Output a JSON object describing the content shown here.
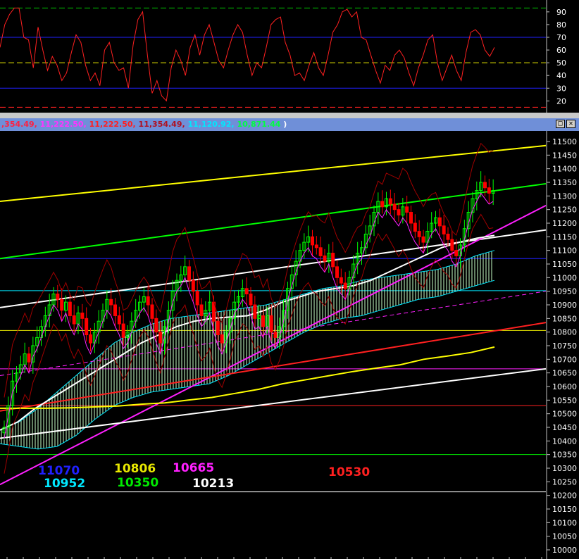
{
  "titlebar": {
    "values": [
      {
        "text": ",354.49,",
        "color": "#ff2040"
      },
      {
        "text": " 11,222.50,",
        "color": "#ff33ff"
      },
      {
        "text": " 11,222.50,",
        "color": "#ff2020"
      },
      {
        "text": " 11,354.49,",
        "color": "#b01020"
      },
      {
        "text": " 11,120.92,",
        "color": "#00e8ff"
      },
      {
        "text": " 10,871.44",
        "color": "#00ff40"
      },
      {
        "text": " )",
        "color": "#ffffff"
      }
    ],
    "minimize_label": "□",
    "close_label": "✕"
  },
  "rsi_panel": {
    "ticks": [
      90,
      80,
      70,
      60,
      50,
      40,
      30,
      20
    ],
    "ylim": [
      13,
      96
    ],
    "levels": [
      {
        "value": 93,
        "color": "#00c800",
        "style": "dashed"
      },
      {
        "value": 70,
        "color": "#2020ff",
        "style": "solid"
      },
      {
        "value": 50,
        "color": "#e8e800",
        "style": "dashed"
      },
      {
        "value": 30,
        "color": "#2020ff",
        "style": "solid"
      },
      {
        "value": 15,
        "color": "#ff2020",
        "style": "dashed"
      }
    ],
    "line_color": "#ff2020",
    "values": [
      62,
      80,
      88,
      93,
      93,
      70,
      68,
      46,
      78,
      60,
      44,
      55,
      48,
      36,
      42,
      58,
      72,
      66,
      48,
      36,
      42,
      32,
      60,
      66,
      50,
      44,
      46,
      30,
      64,
      84,
      90,
      56,
      26,
      36,
      24,
      20,
      46,
      60,
      52,
      40,
      62,
      72,
      56,
      72,
      80,
      66,
      52,
      46,
      60,
      72,
      80,
      74,
      56,
      40,
      50,
      46,
      62,
      80,
      84,
      86,
      66,
      56,
      40,
      42,
      36,
      48,
      58,
      46,
      40,
      56,
      74,
      80,
      90,
      92,
      86,
      90,
      70,
      68,
      56,
      44,
      34,
      48,
      44,
      56,
      60,
      54,
      42,
      32,
      46,
      56,
      68,
      72,
      50,
      36,
      46,
      56,
      44,
      36,
      58,
      74,
      76,
      72,
      60,
      55,
      62
    ]
  },
  "chart_data": {
    "type": "candlestick",
    "title": "",
    "xlabel": "",
    "ylabel": "",
    "ylim": [
      9970,
      11530
    ],
    "yticks": [
      11500,
      11450,
      11400,
      11350,
      11300,
      11250,
      11200,
      11150,
      11100,
      11050,
      11000,
      10950,
      10900,
      10850,
      10800,
      10750,
      10700,
      10650,
      10600,
      10550,
      10500,
      10450,
      10400,
      10350,
      10300,
      10250,
      10200,
      10150,
      10100,
      10050,
      10000
    ],
    "candle_colors": {
      "up": "#00ff00",
      "down": "#ff0000"
    },
    "closes": [
      10450,
      10530,
      10620,
      10650,
      10680,
      10720,
      10690,
      10750,
      10780,
      10820,
      10860,
      10900,
      10940,
      10920,
      10880,
      10910,
      10860,
      10830,
      10870,
      10850,
      10790,
      10760,
      10800,
      10840,
      10880,
      10920,
      10900,
      10860,
      10830,
      10780,
      10800,
      10840,
      10880,
      10910,
      10930,
      10900,
      10850,
      10800,
      10760,
      10820,
      10880,
      10950,
      10990,
      11010,
      11040,
      10990,
      10950,
      10900,
      10860,
      10880,
      10910,
      10840,
      10790,
      10760,
      10800,
      10850,
      10910,
      10930,
      10960,
      10940,
      10900,
      10850,
      10860,
      10820,
      10860,
      10800,
      10780,
      10820,
      10880,
      10960,
      11010,
      11060,
      11100,
      11130,
      11150,
      11120,
      11110,
      11080,
      11060,
      11090,
      11040,
      11000,
      10980,
      10960,
      11000,
      11050,
      11090,
      11110,
      11160,
      11190,
      11240,
      11280,
      11260,
      11290,
      11270,
      11250,
      11230,
      11260,
      11240,
      11200,
      11170,
      11150,
      11130,
      11170,
      11200,
      11220,
      11190,
      11160,
      11140,
      11100,
      11080,
      11120,
      11180,
      11240,
      11290,
      11320,
      11350,
      11330,
      11310,
      11320
    ],
    "horizontal_lines": [
      {
        "label": "11070",
        "value": 11070,
        "color": "#2020ff"
      },
      {
        "label": "10952",
        "value": 10952,
        "color": "#00e8ff"
      },
      {
        "label": "10806",
        "value": 10806,
        "color": "#e8e800"
      },
      {
        "label": "10350",
        "value": 10350,
        "color": "#00e800"
      },
      {
        "label": "10665",
        "value": 10665,
        "color": "#ff20ff"
      },
      {
        "label": "10213",
        "value": 10213,
        "color": "#ffffff"
      },
      {
        "label": "10530",
        "value": 10530,
        "color": "#ff2020"
      }
    ],
    "trendlines": [
      {
        "color": "#ffff00",
        "from": 11280,
        "to": 11485
      },
      {
        "color": "#00ff00",
        "from": 11070,
        "to": 11345
      },
      {
        "color": "#ffffff",
        "from": 10890,
        "to": 11175
      },
      {
        "color": "#ff20ff",
        "from": 10240,
        "to": 11265
      },
      {
        "color": "#ff2020",
        "from": 10510,
        "to": 10835
      },
      {
        "color": "#ffffff",
        "from": 10410,
        "to": 10665
      }
    ],
    "moving_averages": [
      {
        "color": "#ffffff",
        "values": [
          10440,
          10470,
          10520,
          10560,
          10600,
          10640,
          10680,
          10720,
          10760,
          10790,
          10820,
          10840,
          10850,
          10855,
          10860,
          10880,
          10910,
          10930,
          10950,
          10960,
          10970,
          10990,
          11020,
          11050,
          11080,
          11110,
          11130,
          11145,
          11155
        ]
      },
      {
        "color": "#ffff00",
        "values": [
          10520,
          10520,
          10520,
          10522,
          10525,
          10528,
          10535,
          10540,
          10550,
          10560,
          10575,
          10590,
          10610,
          10625,
          10640,
          10655,
          10668,
          10680,
          10700,
          10712,
          10725,
          10745
        ]
      }
    ],
    "annotations": [
      "11070",
      "10952",
      "10806",
      "10350",
      "10665",
      "10213",
      "10530"
    ]
  }
}
